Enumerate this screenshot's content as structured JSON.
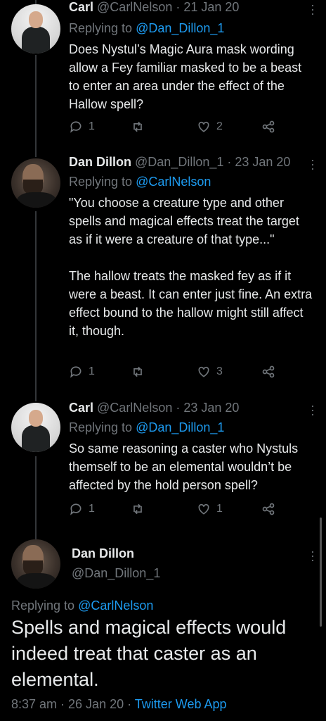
{
  "tweets": [
    {
      "name": "Carl",
      "handle": "@CarlNelson",
      "date": "· 21 Jan 20",
      "replying_prefix": "Replying to",
      "replying_handle": "@Dan_Dillon_1",
      "text": "Does Nystul’s Magic Aura mask wording allow a Fey familiar masked to be a beast to enter an area under the effect of the Hallow spell?",
      "replies": "1",
      "retweets": "",
      "likes": "2"
    },
    {
      "name": "Dan Dillon",
      "handle": "@Dan_Dillon_1",
      "date": "· 23 Jan 20",
      "replying_prefix": "Replying to",
      "replying_handle": "@CarlNelson",
      "text": "\"You choose a creature type and other spells and magical effects treat the target as if it were a creature of that type...\"\n\nThe hallow treats the masked fey as if it were a beast. It can enter just fine. An extra effect bound to the hallow might still affect it, though.",
      "replies": "1",
      "retweets": "",
      "likes": "3"
    },
    {
      "name": "Carl",
      "handle": "@CarlNelson",
      "date": "· 23 Jan 20",
      "replying_prefix": "Replying to",
      "replying_handle": "@Dan_Dillon_1",
      "text": "So same reasoning a caster who Nystuls themself to be an elemental wouldn’t be affected by the hold person spell?",
      "replies": "1",
      "retweets": "",
      "likes": "1"
    }
  ],
  "main_tweet": {
    "name": "Dan Dillon",
    "handle": "@Dan_Dillon_1",
    "replying_prefix": "Replying to",
    "replying_handle": "@CarlNelson",
    "text": "Spells and magical effects would indeed treat that caster as an elemental.",
    "time": "8:37 am · 26 Jan 20 ·",
    "source": "Twitter Web App"
  },
  "colors": {
    "background": "#000000",
    "text": "#e7e9ea",
    "muted": "#71767b",
    "accent": "#1d9bf0"
  },
  "icons": [
    "reply-icon",
    "retweet-icon",
    "like-icon",
    "share-icon",
    "more-icon"
  ]
}
